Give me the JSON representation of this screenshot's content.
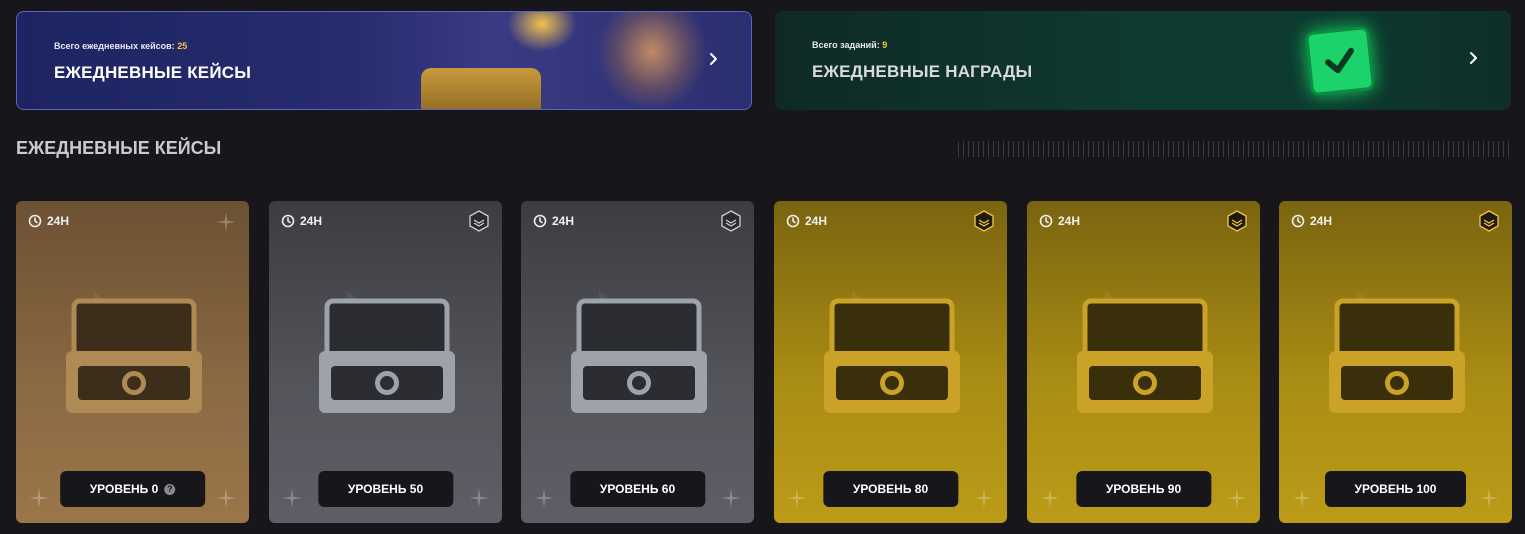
{
  "banners": {
    "cases": {
      "subtitle_prefix": "Всего ежедневных кейсов:",
      "subtitle_count": "25",
      "title": "ЕЖЕДНЕВНЫЕ КЕЙСЫ"
    },
    "rewards": {
      "subtitle_prefix": "Всего заданий:",
      "subtitle_count": "9",
      "title": "ЕЖЕДНЕВНЫЕ НАГРАДЫ"
    }
  },
  "section": {
    "title": "ЕЖЕДНЕВНЫЕ КЕЙСЫ"
  },
  "cards": [
    {
      "timer": "24H",
      "level": "УРОВЕНЬ 0",
      "tier": "bronze",
      "item": "sniper-rifle-icon",
      "has_help": true
    },
    {
      "timer": "24H",
      "level": "УРОВЕНЬ 50",
      "tier": "silver",
      "item": "push-daggers-icon",
      "has_help": false
    },
    {
      "timer": "24H",
      "level": "УРОВЕНЬ 60",
      "tier": "silver",
      "item": "bowie-knife-icon",
      "has_help": false
    },
    {
      "timer": "24H",
      "level": "УРОВЕНЬ 80",
      "tier": "gold",
      "item": "bowie-knife-icon",
      "has_help": false
    },
    {
      "timer": "24H",
      "level": "УРОВЕНЬ 90",
      "tier": "gold",
      "item": "karambit-icon",
      "has_help": false
    },
    {
      "timer": "24H",
      "level": "УРОВЕНЬ 100",
      "tier": "gold",
      "item": "sniper-rifle-icon",
      "has_help": false
    }
  ],
  "colors": {
    "accent": "#f6c744",
    "bronze": "#8c6a43",
    "silver": "#55555c",
    "gold": "#a98c14"
  }
}
